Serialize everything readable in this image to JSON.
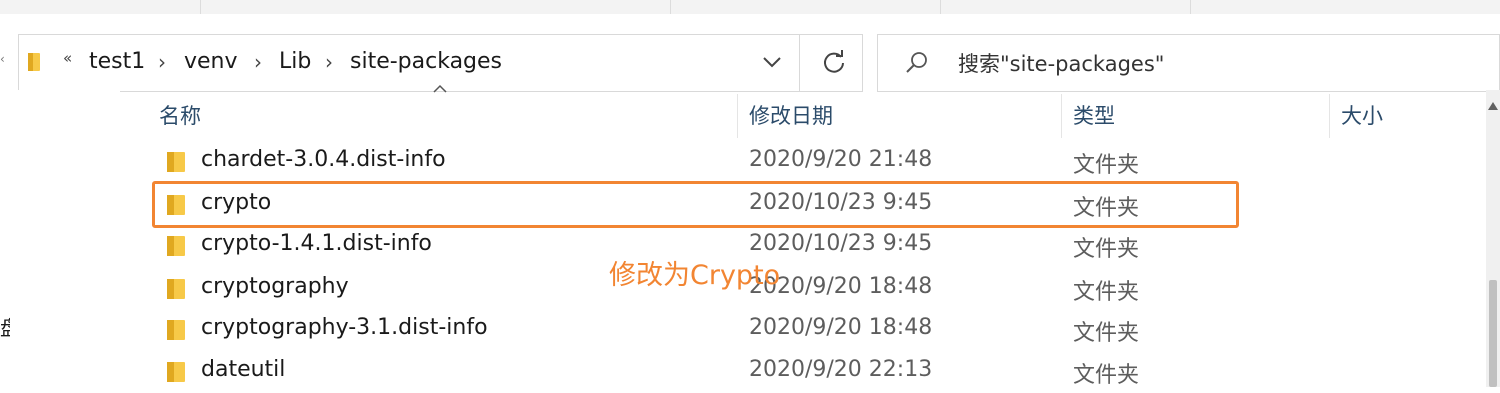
{
  "address": {
    "overflow": "«",
    "crumbs": [
      "test1",
      "venv",
      "Lib",
      "site-packages"
    ]
  },
  "search": {
    "placeholder": "搜索\"site-packages\""
  },
  "left_pane": {
    "partial_text": "盘"
  },
  "columns": {
    "name": "名称",
    "modified": "修改日期",
    "type": "类型",
    "size": "大小"
  },
  "files": [
    {
      "name": "chardet-3.0.4.dist-info",
      "modified": "2020/9/20 21:48",
      "type": "文件夹"
    },
    {
      "name": "crypto",
      "modified": "2020/10/23 9:45",
      "type": "文件夹"
    },
    {
      "name": "crypto-1.4.1.dist-info",
      "modified": "2020/10/23 9:45",
      "type": "文件夹"
    },
    {
      "name": "cryptography",
      "modified": "2020/9/20 18:48",
      "type": "文件夹"
    },
    {
      "name": "cryptography-3.1.dist-info",
      "modified": "2020/9/20 18:48",
      "type": "文件夹"
    },
    {
      "name": "dateutil",
      "modified": "2020/9/20 22:13",
      "type": "文件夹"
    }
  ],
  "annotation": {
    "text": "修改为Crypto",
    "color": "#f28532"
  },
  "colors": {
    "folder": "#f7c948",
    "folder_dark": "#e0a820",
    "highlight": "#f28532",
    "header_text": "#2b4b6a"
  }
}
